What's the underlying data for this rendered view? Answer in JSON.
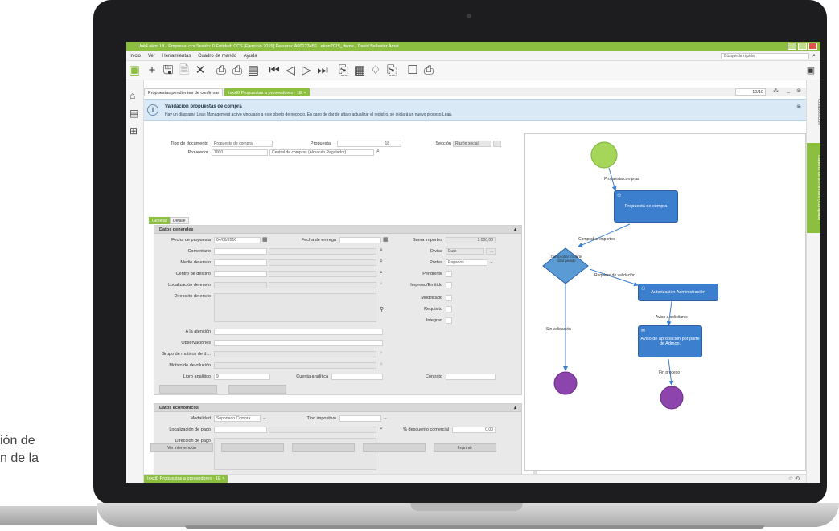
{
  "side_text": {
    "line1": "ión de",
    "line2": "n de la"
  },
  "window": {
    "title": "Unit4 ekon UI · Empresa: ccs Sesión: 0 Entidad: CCS [Ejercicio 2015] Persona: A00123456 · ekon2015_demo · David Bellester Amat",
    "menu": [
      "Inicio",
      "Ver",
      "Herramientas",
      "Cuadro de mando",
      "Ayuda"
    ],
    "quick_search_placeholder": "Búsqueda rápida"
  },
  "toolbar_icons": [
    "add-icon",
    "save-icon",
    "save-copy-icon",
    "delete-icon",
    "print-icon",
    "print-preview-icon",
    "calculator-icon",
    "first-record-icon",
    "prev-record-icon",
    "next-record-icon",
    "last-record-icon",
    "export-icon",
    "document-icon",
    "filter-icon",
    "attach-icon",
    "form-icon",
    "print-report-icon"
  ],
  "doc_tabs": [
    {
      "label": "Propuestas pendientes de confirmar"
    },
    {
      "label": "Ixxxl0 Propuestas a proveedores · 1E ×",
      "active": true
    }
  ],
  "pager": {
    "value": "10/10"
  },
  "banner": {
    "title": "Validación propuestas de compra",
    "text": "Hay un diagrama Lean Management activo vinculado a este objeto de negocio. En caso de dar de alta o actualizar el registro, se iniciará un nuevo proceso Lean.",
    "close": "⊗"
  },
  "header_fields": {
    "tipo_documento_label": "Tipo de documento",
    "tipo_documento_value": "Propuesta de compra",
    "propuesta_label": "Propuesta",
    "propuesta_value": "18",
    "seccion_label": "Sección",
    "seccion_value": "Razón social",
    "proveedor_label": "Proveedor",
    "proveedor_value": "1000",
    "proveedor_name": "Central de compras (Almacén Regulador)"
  },
  "subtabs": [
    "General",
    "Detalle"
  ],
  "datos_generales": {
    "title": "Datos generales",
    "fecha_propuesta_label": "Fecha de propuesta",
    "fecha_propuesta_value": "04/06/2016",
    "fecha_entrega_label": "Fecha de entrega",
    "suma_importes_label": "Suma importes",
    "suma_importes_value": "1.000,00",
    "comentario_label": "Comentario",
    "divisa_label": "Divisa",
    "divisa_value": "Euro",
    "medio_envio_label": "Medio de envío",
    "portes_label": "Portes",
    "portes_value": "Pagados",
    "centro_destino_label": "Centro de destino",
    "pendiente_label": "Pendiente",
    "localizacion_envio_label": "Localización de envío",
    "impreso_label": "Impreso/Emitido",
    "direccion_envio_label": "Dirección de envío",
    "modificado_label": "Modificado",
    "requisito_label": "Requisito",
    "integrad_label": "Integrad",
    "atencion_label": "A la atención",
    "observaciones_label": "Observaciones",
    "grupo_motivos_label": "Grupo de motivos de d…",
    "motivo_devolucion_label": "Motivo de devolución",
    "libro_analitico_label": "Libro analítico",
    "libro_analitico_value": "9",
    "cuenta_analitica_label": "Cuenta analítica",
    "contrato_label": "Contrato"
  },
  "datos_economicos": {
    "title": "Datos económicos",
    "modalidad_label": "Modalidad",
    "modalidad_value": "Soportado Compra",
    "tipo_impositivo_label": "Tipo impositivo",
    "localizacion_pago_label": "Localización de pago",
    "descuento_label": "% descuento comercial",
    "descuento_value": "0,00",
    "direccion_pago_label": "Dirección de pago"
  },
  "bottom_buttons": [
    "Ver intervención",
    "",
    "",
    "",
    "Imprimir"
  ],
  "status_tab": "Ixxxl0 Propuestas a proveedores · 1E ×",
  "right_tabs": [
    "Colaboración",
    "Cadena de suministro (Compras)"
  ],
  "diagram": {
    "labels": {
      "start_edge": "Propuesta compras",
      "node1": "Propuesta de compra",
      "edge2": "Comprobar importes",
      "decision": "Comprobar importe total pedido",
      "edge3": "Requiere de validación",
      "node2": "Autorización Administración",
      "edge4": "Aviso a solicitante",
      "node3": "Aviso de aprobación por parte de Admon.",
      "edge5": "Fin proceso",
      "edge_left": "Sin validación"
    },
    "colors": {
      "start": "#a5d65a",
      "node": "#3d7fcf",
      "end": "#8e44ad",
      "decision": "#5a9bd5"
    }
  }
}
